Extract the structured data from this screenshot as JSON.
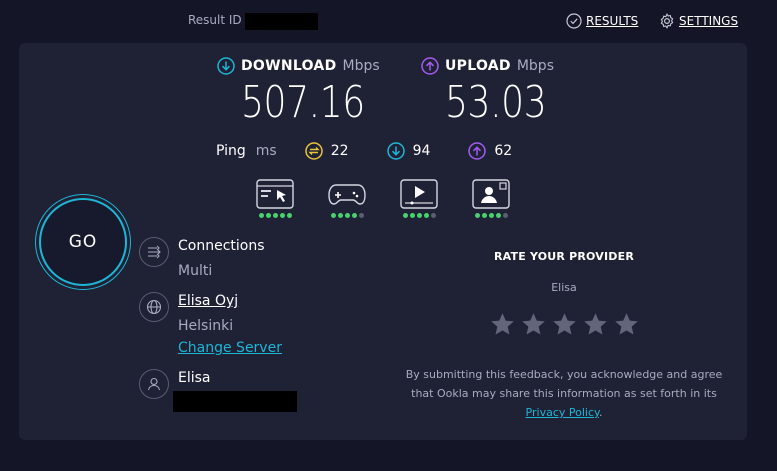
{
  "topbar": {
    "result_id_label": "Result ID",
    "results_label": "RESULTS",
    "settings_label": "SETTINGS"
  },
  "download": {
    "label": "DOWNLOAD",
    "unit": "Mbps",
    "value": "507.16"
  },
  "upload": {
    "label": "UPLOAD",
    "unit": "Mbps",
    "value": "53.03"
  },
  "ping": {
    "label": "Ping",
    "unit": "ms",
    "idle": "22",
    "download": "94",
    "upload": "62"
  },
  "usecases": [
    {
      "name": "web-browsing-icon",
      "rating": 5
    },
    {
      "name": "gaming-icon",
      "rating": 4
    },
    {
      "name": "video-streaming-icon",
      "rating": 4
    },
    {
      "name": "video-chat-icon",
      "rating": 4
    }
  ],
  "go_label": "GO",
  "connections": {
    "title": "Connections",
    "value": "Multi"
  },
  "server": {
    "name": "Elisa Oyj",
    "location": "Helsinki",
    "change_label": "Change Server"
  },
  "provider": {
    "name": "Elisa"
  },
  "rating": {
    "title": "RATE YOUR PROVIDER",
    "provider": "Elisa",
    "stars": 5,
    "disclaimer_text": "By submitting this feedback, you acknowledge and agree that Ookla may share this information as set forth in its",
    "privacy_link": "Privacy Policy",
    "period": "."
  },
  "colors": {
    "background": "#141526",
    "panel": "#1f2135",
    "accent": "#1fb6d6",
    "download_icon": "#1fb6d6",
    "upload_icon": "#a35cf0",
    "ping_icon": "#e8c53a",
    "rating_green": "#48d26e"
  }
}
